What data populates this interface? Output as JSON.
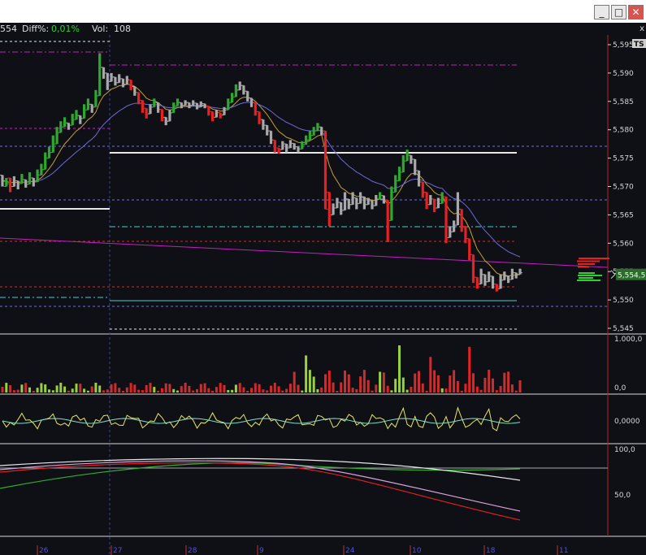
{
  "window": {
    "minimize_label": "_",
    "maximize_label": "□",
    "close_label": "✕",
    "pane_close_label": "x"
  },
  "info": {
    "price_fragment": "554",
    "diff_label": "Diff%:",
    "diff_value": "0,01%",
    "vol_label": "Vol:",
    "vol_value": "108"
  },
  "colors": {
    "background": "#0f1015",
    "up_bar": "#2ea82e",
    "down_bar": "#e82020",
    "neutral_bar": "#a8a8a8",
    "ma_fast": "#c8a030",
    "ma_slow": "#6b6bd8",
    "magenta": "#c020c0",
    "cyan": "#40d0d0",
    "price_tag": "#2e6b2e"
  },
  "chart_data": {
    "type": "candlestick",
    "price_axis": {
      "ticks": [
        "5,595",
        "5,590",
        "5,585",
        "5,580",
        "5,575",
        "5,570",
        "5,565",
        "5,560",
        "5,555",
        "5,550",
        "5,545"
      ],
      "ylim": [
        5.544,
        5.596
      ],
      "current_price_label": "5,554,5",
      "current_price": 5.5545,
      "ts_label": "TS"
    },
    "date_axis": {
      "ticks": [
        "26",
        "27",
        "28",
        "9",
        "24",
        "10",
        "18",
        "11"
      ]
    },
    "bars": [
      [
        5.572,
        5.57,
        5.571,
        "n"
      ],
      [
        5.57,
        5.5715,
        5.5705,
        "g"
      ],
      [
        5.5715,
        5.569,
        5.57,
        "r"
      ],
      [
        5.57,
        5.5718,
        5.571,
        "n"
      ],
      [
        5.571,
        5.5695,
        5.5705,
        "n"
      ],
      [
        5.5705,
        5.5722,
        5.5712,
        "g"
      ],
      [
        5.5712,
        5.5698,
        5.5704,
        "n"
      ],
      [
        5.5704,
        5.5725,
        5.5715,
        "g"
      ],
      [
        5.5715,
        5.57,
        5.5708,
        "n"
      ],
      [
        5.5708,
        5.573,
        5.572,
        "g"
      ],
      [
        5.572,
        5.574,
        5.573,
        "g"
      ],
      [
        5.573,
        5.576,
        5.575,
        "g"
      ],
      [
        5.575,
        5.577,
        5.576,
        "g"
      ],
      [
        5.576,
        5.579,
        5.5775,
        "g"
      ],
      [
        5.5775,
        5.5805,
        5.5795,
        "g"
      ],
      [
        5.5795,
        5.5815,
        5.5805,
        "g"
      ],
      [
        5.5805,
        5.5822,
        5.5812,
        "g"
      ],
      [
        5.5812,
        5.58,
        5.5808,
        "n"
      ],
      [
        5.5808,
        5.5828,
        5.5818,
        "g"
      ],
      [
        5.5818,
        5.5835,
        5.5825,
        "g"
      ],
      [
        5.5825,
        5.581,
        5.582,
        "n"
      ],
      [
        5.582,
        5.5845,
        5.5835,
        "g"
      ],
      [
        5.5835,
        5.5855,
        5.5845,
        "g"
      ],
      [
        5.5845,
        5.583,
        5.584,
        "n"
      ],
      [
        5.584,
        5.587,
        5.586,
        "g"
      ],
      [
        5.586,
        5.5935,
        5.591,
        "g"
      ],
      [
        5.591,
        5.589,
        5.59,
        "n"
      ],
      [
        5.59,
        5.587,
        5.5885,
        "n"
      ],
      [
        5.5885,
        5.59,
        5.5893,
        "n"
      ],
      [
        5.5893,
        5.5878,
        5.5883,
        "n"
      ],
      [
        5.5883,
        5.5898,
        5.589,
        "n"
      ],
      [
        5.589,
        5.5875,
        5.588,
        "n"
      ],
      [
        5.588,
        5.5895,
        5.5888,
        "n"
      ],
      [
        5.5888,
        5.587,
        5.5876,
        "r"
      ],
      [
        5.5876,
        5.586,
        5.5866,
        "n"
      ],
      [
        5.5866,
        5.5845,
        5.5852,
        "r"
      ],
      [
        5.5852,
        5.583,
        5.5838,
        "r"
      ],
      [
        5.5838,
        5.582,
        5.5828,
        "r"
      ],
      [
        5.5828,
        5.5845,
        5.584,
        "n"
      ],
      [
        5.584,
        5.5855,
        5.5848,
        "g"
      ],
      [
        5.5848,
        5.583,
        5.5836,
        "n"
      ],
      [
        5.5836,
        5.5815,
        5.5822,
        "r"
      ],
      [
        5.5822,
        5.5808,
        5.5815,
        "n"
      ],
      [
        5.5815,
        5.5835,
        5.583,
        "n"
      ],
      [
        5.583,
        5.5848,
        5.5842,
        "g"
      ],
      [
        5.5842,
        5.5855,
        5.5848,
        "g"
      ],
      [
        5.5848,
        5.5838,
        5.5843,
        "n"
      ],
      [
        5.5843,
        5.5852,
        5.5848,
        "n"
      ],
      [
        5.5848,
        5.5838,
        5.5843,
        "n"
      ],
      [
        5.5843,
        5.5852,
        5.5847,
        "n"
      ],
      [
        5.5847,
        5.5836,
        5.584,
        "n"
      ],
      [
        5.584,
        5.585,
        5.5846,
        "n"
      ],
      [
        5.5846,
        5.5838,
        5.5842,
        "n"
      ],
      [
        5.5842,
        5.5825,
        5.5832,
        "r"
      ],
      [
        5.5832,
        5.5815,
        5.5822,
        "r"
      ],
      [
        5.5822,
        5.5835,
        5.583,
        "n"
      ],
      [
        5.583,
        5.582,
        5.5826,
        "r"
      ],
      [
        5.5826,
        5.584,
        5.5835,
        "n"
      ],
      [
        5.5835,
        5.5855,
        5.5848,
        "g"
      ],
      [
        5.5848,
        5.5865,
        5.5858,
        "g"
      ],
      [
        5.5858,
        5.588,
        5.587,
        "g"
      ],
      [
        5.587,
        5.5885,
        5.5878,
        "n"
      ],
      [
        5.5878,
        5.5862,
        5.5868,
        "n"
      ],
      [
        5.5868,
        5.585,
        5.5856,
        "n"
      ],
      [
        5.5856,
        5.584,
        5.5848,
        "n"
      ],
      [
        5.5848,
        5.5825,
        5.5832,
        "r"
      ],
      [
        5.5832,
        5.581,
        5.5818,
        "r"
      ],
      [
        5.5818,
        5.58,
        5.5808,
        "n"
      ],
      [
        5.5808,
        5.579,
        5.5798,
        "n"
      ],
      [
        5.5798,
        5.5775,
        5.5782,
        "n"
      ],
      [
        5.5782,
        5.576,
        5.5768,
        "r"
      ],
      [
        5.5768,
        5.5758,
        5.5765,
        "r"
      ],
      [
        5.5765,
        5.578,
        5.5775,
        "n"
      ],
      [
        5.5775,
        5.576,
        5.5768,
        "n"
      ],
      [
        5.5768,
        5.5782,
        5.5776,
        "n"
      ],
      [
        5.5776,
        5.5765,
        5.577,
        "n"
      ],
      [
        5.577,
        5.576,
        5.5766,
        "n"
      ],
      [
        5.5766,
        5.578,
        5.5774,
        "g"
      ],
      [
        5.5774,
        5.579,
        5.5782,
        "g"
      ],
      [
        5.5782,
        5.5798,
        5.579,
        "g"
      ],
      [
        5.579,
        5.5805,
        5.5798,
        "g"
      ],
      [
        5.5798,
        5.5812,
        5.5805,
        "g"
      ],
      [
        5.5805,
        5.579,
        5.5798,
        "n"
      ],
      [
        5.5798,
        5.57,
        5.566,
        "r"
      ],
      [
        5.569,
        5.563,
        5.565,
        "r"
      ],
      [
        5.565,
        5.567,
        5.5662,
        "n"
      ],
      [
        5.5662,
        5.568,
        5.5672,
        "n"
      ],
      [
        5.5672,
        5.565,
        5.5658,
        "n"
      ],
      [
        5.5658,
        5.569,
        5.5678,
        "n"
      ],
      [
        5.5678,
        5.566,
        5.5668,
        "n"
      ],
      [
        5.5668,
        5.569,
        5.568,
        "n"
      ],
      [
        5.568,
        5.566,
        5.567,
        "n"
      ],
      [
        5.567,
        5.569,
        5.5682,
        "n"
      ],
      [
        5.5682,
        5.566,
        5.5668,
        "n"
      ],
      [
        5.5668,
        5.568,
        5.5675,
        "n"
      ],
      [
        5.5675,
        5.566,
        5.5666,
        "n"
      ],
      [
        5.5666,
        5.5685,
        5.5678,
        "n"
      ],
      [
        5.5678,
        5.569,
        5.5684,
        "g"
      ],
      [
        5.5684,
        5.567,
        5.5676,
        "n"
      ],
      [
        5.5676,
        5.5602,
        5.564,
        "r"
      ],
      [
        5.564,
        5.57,
        5.569,
        "g"
      ],
      [
        5.569,
        5.572,
        5.571,
        "g"
      ],
      [
        5.571,
        5.5735,
        5.5725,
        "g"
      ],
      [
        5.5725,
        5.5755,
        5.5745,
        "g"
      ],
      [
        5.5745,
        5.5765,
        5.5755,
        "g"
      ],
      [
        5.5755,
        5.574,
        5.5748,
        "n"
      ],
      [
        5.5748,
        5.572,
        5.5728,
        "n"
      ],
      [
        5.5728,
        5.57,
        5.5708,
        "n"
      ],
      [
        5.5708,
        5.568,
        5.569,
        "r"
      ],
      [
        5.569,
        5.566,
        5.5668,
        "r"
      ],
      [
        5.5668,
        5.5685,
        5.5678,
        "n"
      ],
      [
        5.5678,
        5.5655,
        5.5662,
        "r"
      ],
      [
        5.5662,
        5.568,
        5.567,
        "n"
      ],
      [
        5.567,
        5.569,
        5.5682,
        "g"
      ],
      [
        5.5682,
        5.56,
        5.561,
        "r"
      ],
      [
        5.561,
        5.563,
        5.562,
        "n"
      ],
      [
        5.562,
        5.564,
        5.5632,
        "n"
      ],
      [
        5.5632,
        5.569,
        5.566,
        "n"
      ],
      [
        5.566,
        5.562,
        5.563,
        "r"
      ],
      [
        5.563,
        5.56,
        5.5608,
        "r"
      ],
      [
        5.5608,
        5.557,
        5.558,
        "r"
      ],
      [
        5.558,
        5.553,
        5.554,
        "r"
      ],
      [
        5.554,
        5.552,
        5.5528,
        "r"
      ],
      [
        5.5528,
        5.5555,
        5.5545,
        "n"
      ],
      [
        5.5545,
        5.5525,
        5.5532,
        "n"
      ],
      [
        5.5532,
        5.555,
        5.5542,
        "n"
      ],
      [
        5.5542,
        5.552,
        5.5528,
        "n"
      ],
      [
        5.5528,
        5.5515,
        5.552,
        "r"
      ],
      [
        5.552,
        5.5545,
        5.5535,
        "n"
      ],
      [
        5.5535,
        5.555,
        5.5542,
        "n"
      ],
      [
        5.5542,
        5.553,
        5.5536,
        "n"
      ],
      [
        5.5536,
        5.5555,
        5.5548,
        "n"
      ],
      [
        5.5548,
        5.5538,
        5.5545,
        "n"
      ],
      [
        5.5545,
        5.5555,
        5.5548,
        "n"
      ]
    ],
    "volume_axis": {
      "ticks": [
        "1.000,0",
        "0,0"
      ]
    },
    "oscillator_axis": {
      "ticks": [
        "0,0000"
      ]
    },
    "stochastic_axis": {
      "ticks": [
        "100,0",
        "50,0"
      ]
    }
  }
}
